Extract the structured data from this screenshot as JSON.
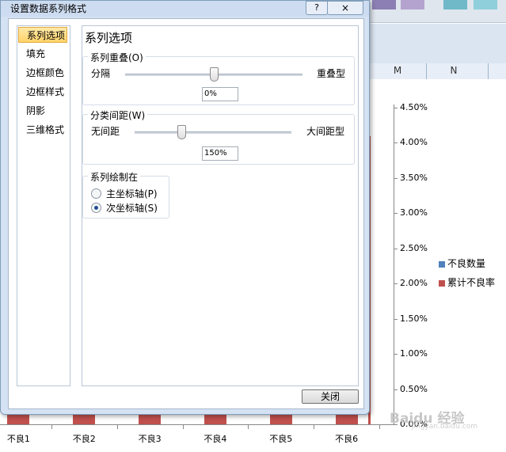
{
  "dialog": {
    "title": "设置数据系列格式",
    "help_label": "?",
    "close_x_label": "×",
    "close_button_label": "关闭"
  },
  "sidebar": {
    "items": [
      {
        "label": "系列选项",
        "active": true
      },
      {
        "label": "填充",
        "active": false
      },
      {
        "label": "边框颜色",
        "active": false
      },
      {
        "label": "边框样式",
        "active": false
      },
      {
        "label": "阴影",
        "active": false
      },
      {
        "label": "三维格式",
        "active": false
      }
    ]
  },
  "series_options": {
    "heading": "系列选项",
    "overlap": {
      "legend": "系列重叠(O)",
      "min_label": "分隔",
      "max_label": "重叠型",
      "value": "0%",
      "slider_fraction": 0.5
    },
    "gap_width": {
      "legend": "分类间距(W)",
      "min_label": "无间距",
      "max_label": "大间距型",
      "value": "150%",
      "slider_fraction": 0.3
    },
    "plot_on": {
      "legend": "系列绘制在",
      "options": [
        {
          "label": "主坐标轴(P)",
          "checked": false
        },
        {
          "label": "次坐标轴(S)",
          "checked": true
        }
      ]
    }
  },
  "spreadsheet": {
    "columns": [
      "M",
      "N"
    ]
  },
  "chart_data": {
    "type": "bar",
    "categories": [
      "不良1",
      "不良2",
      "不良3",
      "不良4",
      "不良5",
      "不良6"
    ],
    "series": [
      {
        "name": "不良数量",
        "color": "#4f81bd"
      },
      {
        "name": "累计不良率",
        "color": "#c0504d"
      }
    ],
    "y2_ticks": [
      "4.50%",
      "4.00%",
      "3.50%",
      "3.00%",
      "2.50%",
      "2.00%",
      "1.50%",
      "1.00%",
      "0.50%",
      "0.00%"
    ],
    "y2lim": [
      0,
      4.5
    ]
  },
  "watermark": {
    "text": "Baidu 经验",
    "sub": "jingyan.baidu.com"
  }
}
